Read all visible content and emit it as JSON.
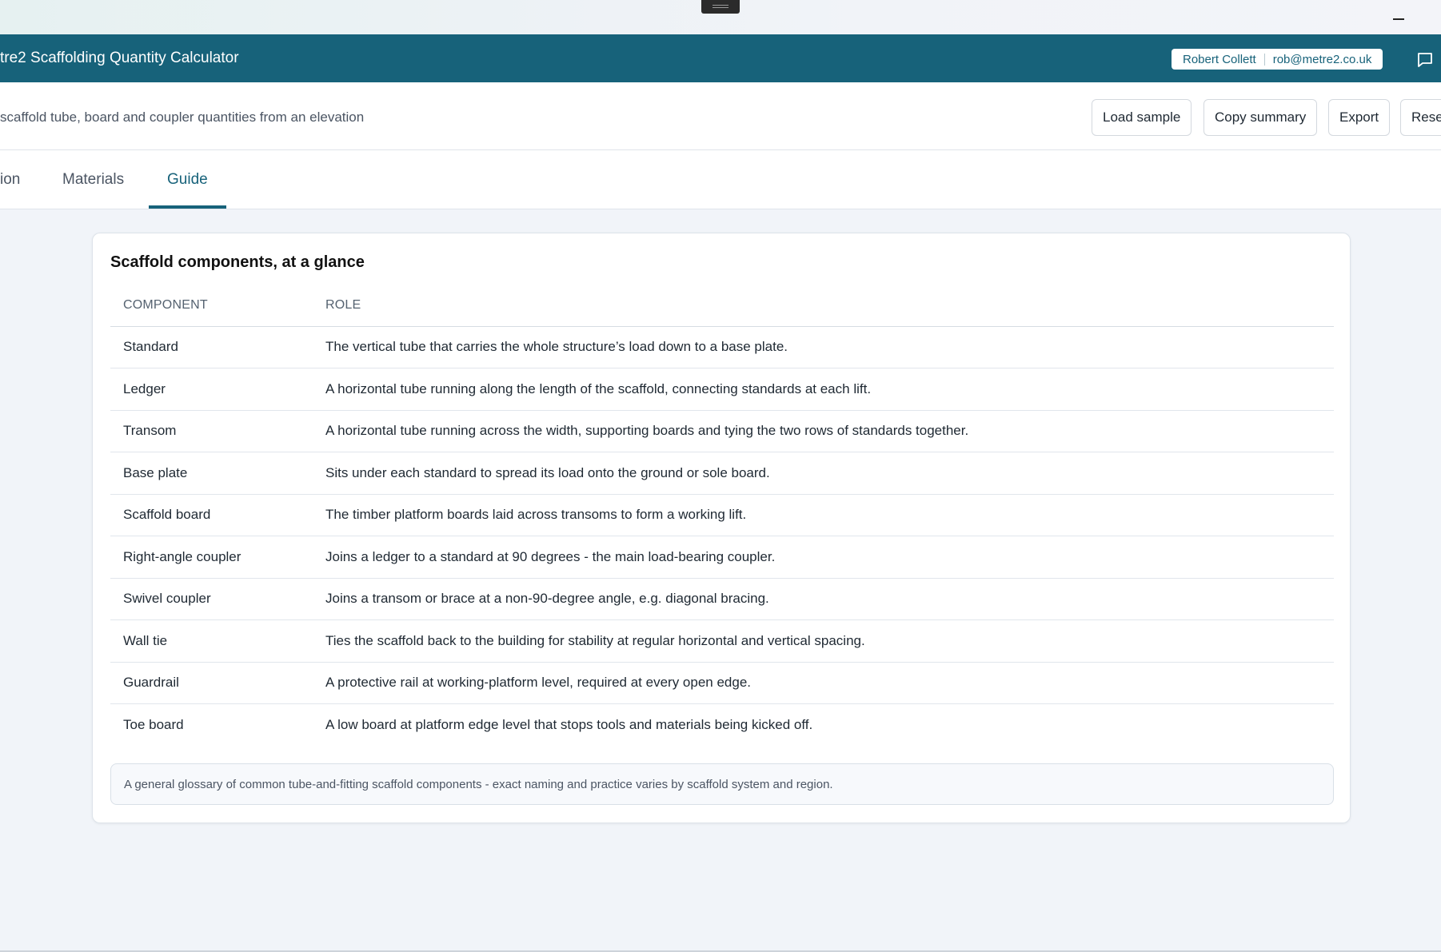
{
  "app": {
    "title": "tre2 Scaffolding Quantity Calculator",
    "user_name": "Robert Collett",
    "user_email": "rob@metre2.co.uk"
  },
  "header": {
    "subtitle": "scaffold tube, board and coupler quantities from an elevation",
    "buttons": {
      "load_sample": "Load sample",
      "copy_summary": "Copy summary",
      "export": "Export",
      "reset": "Rese"
    }
  },
  "tabs": [
    {
      "label": "ion"
    },
    {
      "label": "Materials"
    },
    {
      "label": "Guide"
    }
  ],
  "guide": {
    "title": "Scaffold components, at a glance",
    "columns": [
      "COMPONENT",
      "ROLE"
    ],
    "rows": [
      {
        "component": "Standard",
        "role": "The vertical tube that carries the whole structure’s load down to a base plate."
      },
      {
        "component": "Ledger",
        "role": "A horizontal tube running along the length of the scaffold, connecting standards at each lift."
      },
      {
        "component": "Transom",
        "role": "A horizontal tube running across the width, supporting boards and tying the two rows of standards together."
      },
      {
        "component": "Base plate",
        "role": "Sits under each standard to spread its load onto the ground or sole board."
      },
      {
        "component": "Scaffold board",
        "role": "The timber platform boards laid across transoms to form a working lift."
      },
      {
        "component": "Right-angle coupler",
        "role": "Joins a ledger to a standard at 90 degrees - the main load-bearing coupler."
      },
      {
        "component": "Swivel coupler",
        "role": "Joins a transom or brace at a non-90-degree angle, e.g. diagonal bracing."
      },
      {
        "component": "Wall tie",
        "role": "Ties the scaffold back to the building for stability at regular horizontal and vertical spacing."
      },
      {
        "component": "Guardrail",
        "role": "A protective rail at working-platform level, required at every open edge."
      },
      {
        "component": "Toe board",
        "role": "A low board at platform edge level that stops tools and materials being kicked off."
      }
    ],
    "note": "A general glossary of common tube-and-fitting scaffold components - exact naming and practice varies by scaffold system and region."
  },
  "colors": {
    "brand": "#17627a",
    "background": "#f1f4f9"
  },
  "active_tab": "Guide"
}
